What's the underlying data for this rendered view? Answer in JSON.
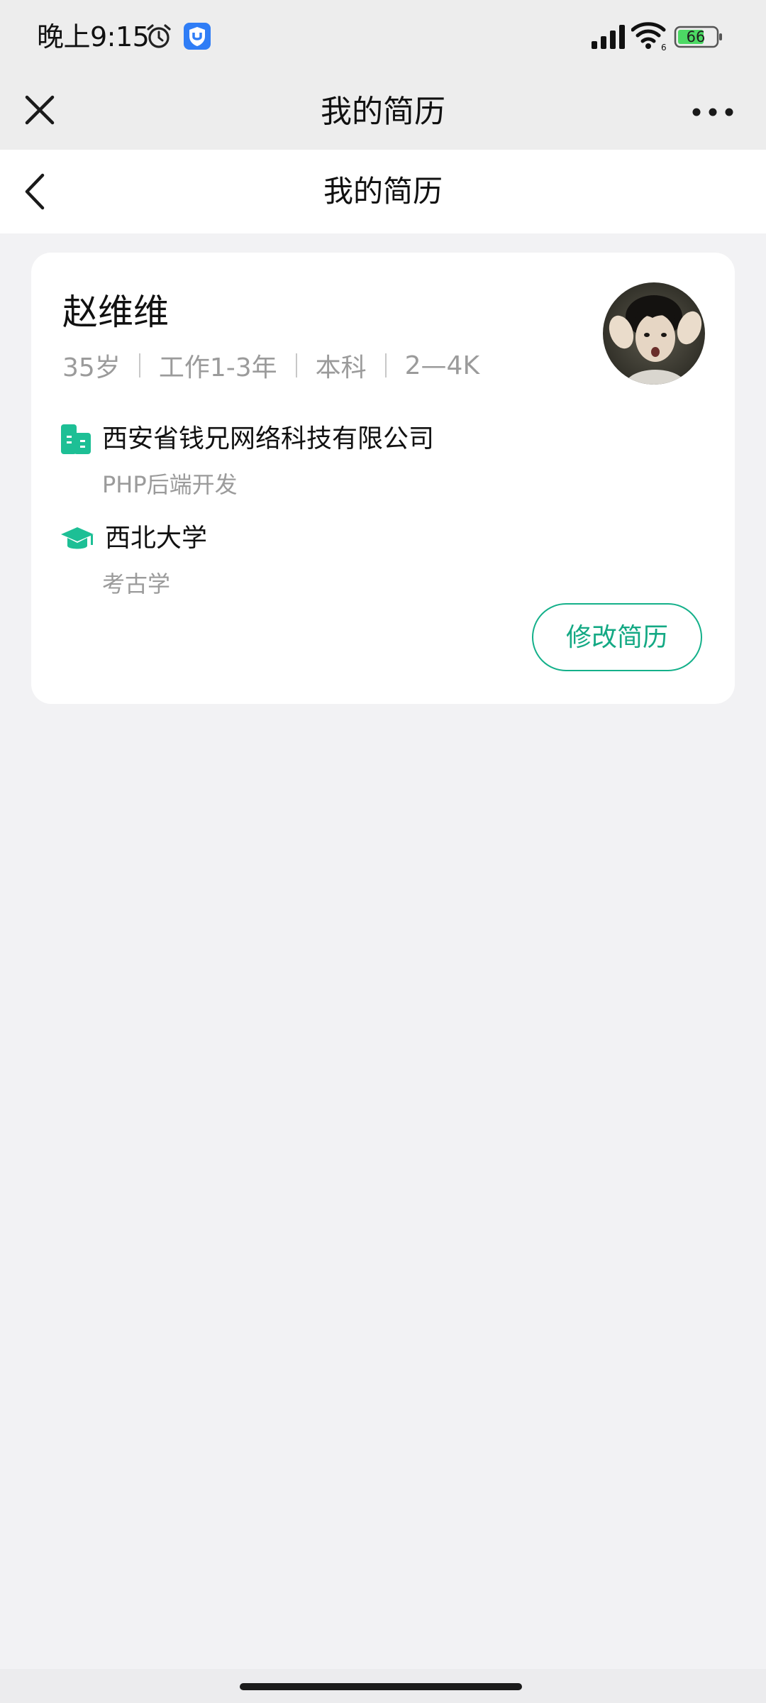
{
  "status_bar": {
    "time": "晚上9:15",
    "battery": "66",
    "wifi_sub": "6"
  },
  "top_nav": {
    "title": "我的简历"
  },
  "header": {
    "title": "我的简历"
  },
  "profile": {
    "name": "赵维维",
    "meta": [
      "35岁",
      "工作1-3年",
      "本科",
      "2—4K"
    ],
    "company": "西安省钱兄网络科技有限公司",
    "role": "PHP后端开发",
    "school": "西北大学",
    "major": "考古学",
    "edit_button": "修改简历"
  },
  "colors": {
    "accent": "#14b08a",
    "page_bg": "#f2f2f4",
    "secondary_text": "#9b9b9b"
  },
  "icons": {
    "alarm": "alarm-clock-icon",
    "app_badge": "shield-app-icon",
    "signal": "cellular-signal-icon",
    "wifi": "wifi-icon",
    "battery": "battery-icon",
    "close": "close-icon",
    "more": "more-dots-icon",
    "back": "chevron-left-icon",
    "company": "building-icon",
    "school": "graduation-cap-icon"
  }
}
